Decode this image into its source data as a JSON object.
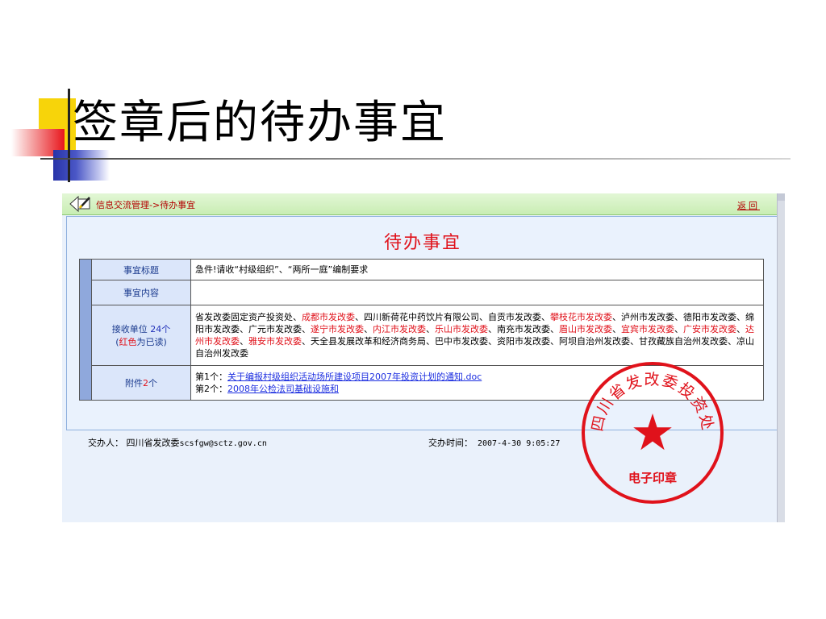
{
  "slide": {
    "title": "签章后的待办事宜"
  },
  "topbar": {
    "breadcrumb": "信息交流管理->待办事宜",
    "back_label": "返回"
  },
  "panel": {
    "title": "待办事宜"
  },
  "form": {
    "title_label": "事宜标题",
    "title_value": "急件!请收“村级组织”、“两所一庭”编制要求",
    "content_label": "事宜内容",
    "content_value": "",
    "units_label": "接收单位",
    "units_count": "24个",
    "units_note_open": "(",
    "units_note_red": "红色",
    "units_note_rest": "为已读)",
    "units": [
      {
        "name": "省发改委固定资产投资处",
        "read": false
      },
      {
        "name": "成都市发改委",
        "read": true
      },
      {
        "name": "四川新荷花中药饮片有限公司",
        "read": false
      },
      {
        "name": "自贡市发改委",
        "read": false
      },
      {
        "name": "攀枝花市发改委",
        "read": true
      },
      {
        "name": "泸州市发改委",
        "read": false
      },
      {
        "name": "德阳市发改委",
        "read": false
      },
      {
        "name": "绵阳市发改委",
        "read": false
      },
      {
        "name": "广元市发改委",
        "read": false
      },
      {
        "name": "遂宁市发改委",
        "read": true
      },
      {
        "name": "内江市发改委",
        "read": true
      },
      {
        "name": "乐山市发改委",
        "read": true
      },
      {
        "name": "南充市发改委",
        "read": false
      },
      {
        "name": "眉山市发改委",
        "read": true
      },
      {
        "name": "宜宾市发改委",
        "read": true
      },
      {
        "name": "广安市发改委",
        "read": true
      },
      {
        "name": "达州市发改委",
        "read": true
      },
      {
        "name": "雅安市发改委",
        "read": true
      },
      {
        "name": "天全县发展改革和经济商务局",
        "read": false
      },
      {
        "name": "巴中市发改委",
        "read": false
      },
      {
        "name": "资阳市发改委",
        "read": false
      },
      {
        "name": "阿坝自治州发改委",
        "read": false
      },
      {
        "name": "甘孜藏族自治州发改委",
        "read": false
      },
      {
        "name": "凉山自治州发改委",
        "read": false
      }
    ],
    "attach_label": "附件",
    "attach_count": "2",
    "attach_unit": "个",
    "attachments": [
      {
        "prefix": "第1个：",
        "name": "关于编报村级组织活动场所建设项目2007年投资计划的通知.doc"
      },
      {
        "prefix": "第2个：",
        "name": "2008年公检法司基础设施和"
      }
    ]
  },
  "footer": {
    "handler_label": "交办人：",
    "handler_name": "四川省发改委",
    "handler_email": "scsfgw@sctz.gov.cn",
    "time_label": "交办时间：",
    "time_value": "2007-4-30 9:05:27"
  },
  "seal": {
    "ring_text": "四川省发改委投资处",
    "center_text": "电子印章"
  },
  "colors": {
    "seal_red": "#e0121b",
    "read_red": "#e0121b",
    "link_blue": "#1c2ee0"
  }
}
